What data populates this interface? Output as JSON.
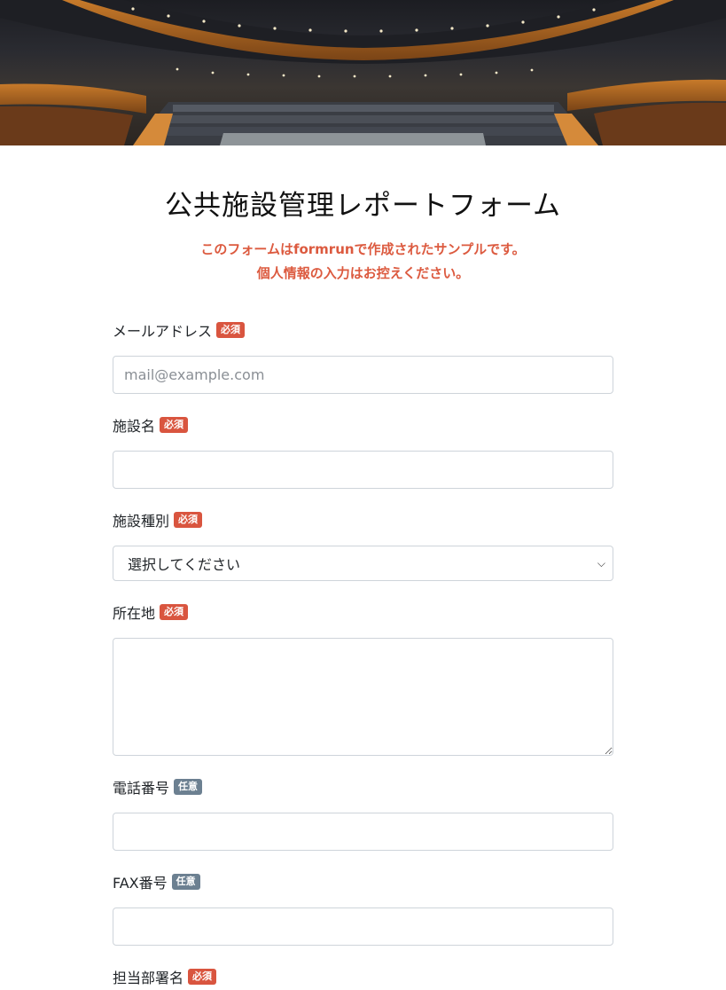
{
  "hero": {
    "image": "concert-hall-photo"
  },
  "form": {
    "title": "公共施設管理レポートフォーム",
    "notice_line1": "このフォームはformrunで作成されたサンプルです。",
    "notice_line2": "個人情報の入力はお控えください。",
    "badges": {
      "required": "必須",
      "optional": "任意"
    },
    "fields": {
      "email": {
        "label": "メールアドレス",
        "placeholder": "mail@example.com",
        "value": ""
      },
      "facility_name": {
        "label": "施設名",
        "value": ""
      },
      "facility_type": {
        "label": "施設種別",
        "selected": "選択してください"
      },
      "address": {
        "label": "所在地",
        "value": ""
      },
      "phone": {
        "label": "電話番号",
        "value": ""
      },
      "fax": {
        "label": "FAX番号",
        "value": ""
      },
      "department": {
        "label": "担当部署名"
      }
    }
  },
  "colors": {
    "accent_red": "#dc5a3f",
    "optional_badge": "#6c8091",
    "border": "#ced4da"
  }
}
